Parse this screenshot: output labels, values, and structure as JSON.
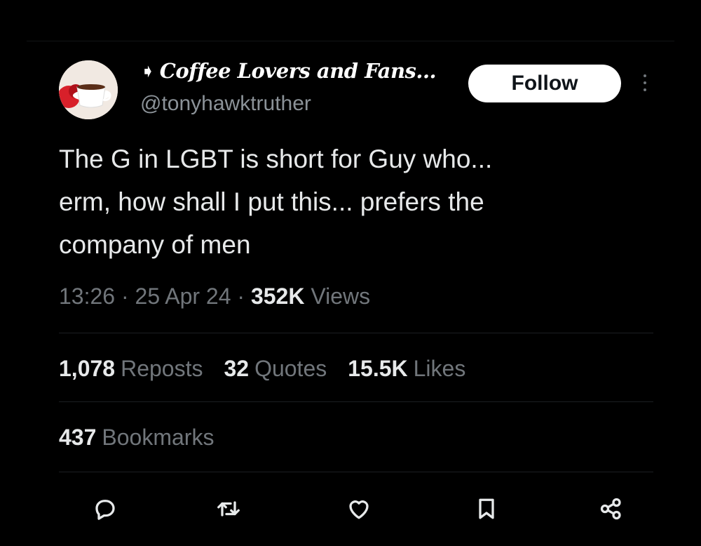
{
  "author": {
    "display_name": "Coffee Lovers and Fans...",
    "handle": "@tonyhawktruther",
    "avatar_icon": "coffee-cup-avatar"
  },
  "follow_label": "Follow",
  "tweet": {
    "lines": [
      "The G in LGBT is short for Guy who...",
      "erm, how shall I put this... prefers the",
      "company of men"
    ]
  },
  "meta": {
    "time": "13:26",
    "sep1": " · ",
    "date": "25 Apr 24",
    "sep2": " · ",
    "views_count": "352K",
    "views_label": "Views"
  },
  "stats": {
    "reposts_count": "1,078",
    "reposts_label": "Reposts",
    "quotes_count": "32",
    "quotes_label": "Quotes",
    "likes_count": "15.5K",
    "likes_label": "Likes",
    "bookmarks_count": "437",
    "bookmarks_label": "Bookmarks"
  },
  "actions": [
    "reply-icon",
    "repost-icon",
    "like-icon",
    "bookmark-icon",
    "share-icon"
  ],
  "colors": {
    "background": "#000000",
    "primary_text": "#e7e9ea",
    "secondary_text": "#71767b",
    "follow_bg": "#ffffff"
  }
}
